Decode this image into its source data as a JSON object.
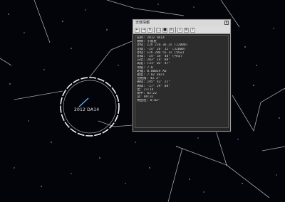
{
  "window": {
    "title": "天体情報",
    "close_glyph": "x",
    "toolbar": [
      {
        "name": "back-icon",
        "glyph": "←"
      },
      {
        "name": "forward-icon",
        "glyph": "→"
      },
      {
        "name": "reload-icon",
        "glyph": "↻"
      },
      {
        "name": "copy-icon",
        "glyph": "□"
      },
      {
        "name": "save-icon",
        "glyph": "■"
      },
      {
        "name": "print-icon",
        "glyph": "≡"
      },
      {
        "name": "search-icon",
        "glyph": "⌕"
      },
      {
        "name": "settings-icon",
        "glyph": "⚙"
      },
      {
        "name": "help-icon",
        "glyph": "?"
      }
    ],
    "rows": [
      "名称: 2012 DA14",
      "種類: 小惑星",
      "赤経: 12h 27m 36.2s (J2000)",
      "赤緯: -24° 26' 12\" (J2000)",
      "赤経: 12h 28m 55.1s (今日)",
      "赤緯: -24° 34' 48\" (今日)",
      "方位: 203° 14' 09\"",
      "高度: +31° 02' 47\"",
      "等級: 7.0",
      "距離: 0.00019 AU",
      "速度: 7.82 km/s",
      "位相角: 42.3°",
      "黄経: 195° 43' 21\"",
      "黄緯: -17° 29' 08\"",
      "出: 21:14",
      "南中: 03:22",
      "没: 09:31",
      "視直径: 0.02\""
    ]
  },
  "target": {
    "label": "2012 DA14"
  }
}
